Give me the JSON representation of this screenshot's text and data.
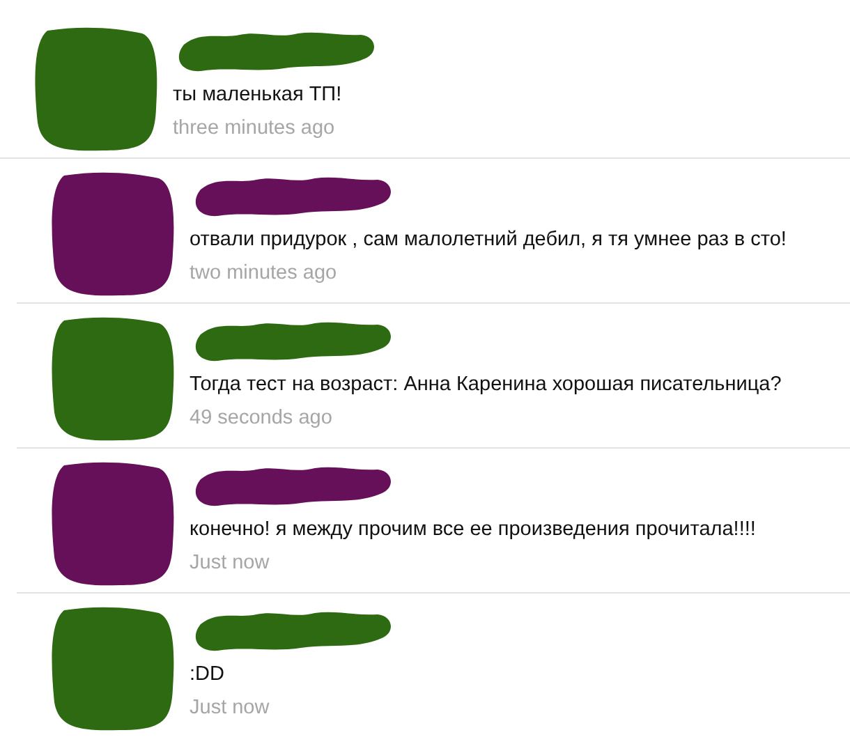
{
  "comments": [
    {
      "color": "#2d6a12",
      "text": "ты маленькая ТП!",
      "time": "three minutes ago"
    },
    {
      "color": "#651058",
      "text": "отвали придурок , сам малолетний дебил, я тя умнее раз в сто!",
      "time": "two minutes ago"
    },
    {
      "color": "#2d6a12",
      "text": "Тогда тест на возраст: Анна Каренина хорошая писательница?",
      "time": "49 seconds ago"
    },
    {
      "color": "#651058",
      "text": "конечно! я между прочим все ее произведения прочитала!!!!",
      "time": "Just now"
    },
    {
      "color": "#2d6a12",
      "text": ":DD",
      "time": "Just now"
    }
  ]
}
